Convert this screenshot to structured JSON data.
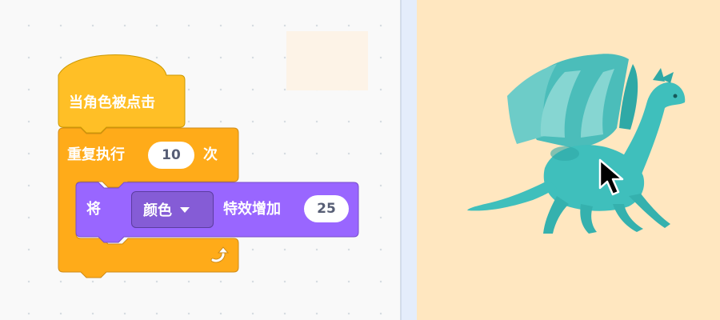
{
  "workspace": {
    "hat_block": {
      "label": "当角色被点击"
    },
    "repeat_block": {
      "label": "重复执行",
      "count": "10",
      "suffix": "次"
    },
    "effect_block": {
      "prefix": "将",
      "effect_dropdown": {
        "selected": "颜色"
      },
      "middle": "特效增加",
      "amount": "25"
    }
  },
  "stage": {
    "sprite": "dragon-sprite"
  },
  "colors": {
    "events": "#ffbf26",
    "control": "#ffab19",
    "looks": "#9966ff",
    "stage_bg": "#ffe7c0",
    "workspace_bg": "#f9f9f9"
  },
  "icons": [
    "repeat-arrow-icon",
    "dropdown-caret-icon",
    "mouse-cursor-icon"
  ]
}
